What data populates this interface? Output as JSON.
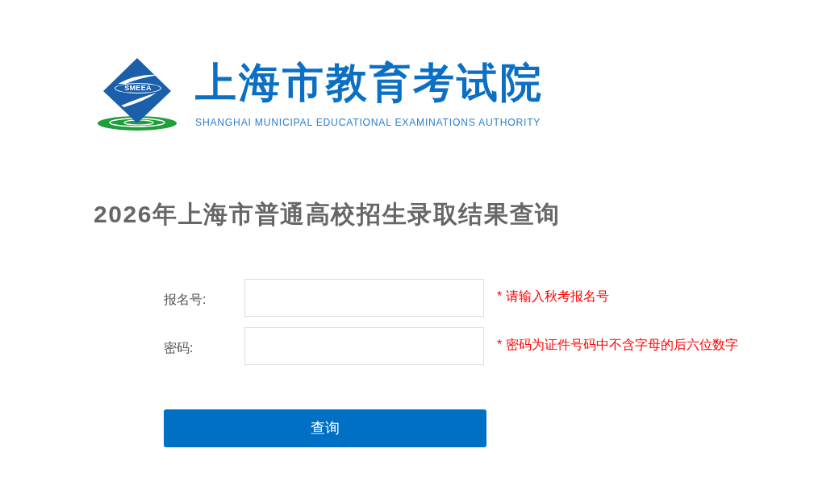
{
  "header": {
    "logo_text": "SMEEA",
    "title": "上海市教育考试院",
    "subtitle": "SHANGHAI MUNICIPAL EDUCATIONAL EXAMINATIONS AUTHORITY"
  },
  "heading": "2026年上海市普通高校招生录取结果查询",
  "form": {
    "fields": [
      {
        "label": "报名号:",
        "hint": "* 请输入秋考报名号"
      },
      {
        "label": "密码:",
        "hint": "* 密码为证件号码中不含字母的后六位数字"
      }
    ],
    "submit": "查询"
  }
}
